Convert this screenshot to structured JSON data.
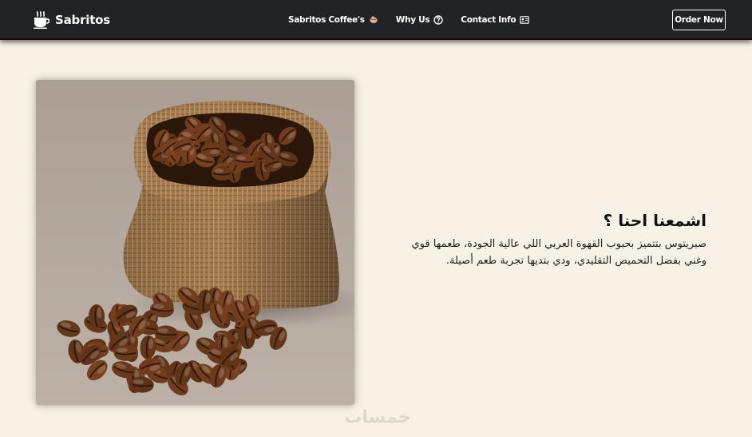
{
  "brand": {
    "name": "Sabritos",
    "icon": "coffee-cup-icon"
  },
  "nav": {
    "items": [
      {
        "label": "Sabritos Coffee's",
        "icon": "coffee-bean-icon"
      },
      {
        "label": "Why Us",
        "icon": "question-circle-icon"
      },
      {
        "label": "Contact Info",
        "icon": "id-card-icon"
      }
    ],
    "order_label": "Order Now"
  },
  "hero": {
    "image": "coffee-beans-sack-photo"
  },
  "about": {
    "title": "اشمعنا احنا ؟",
    "text": "صبريتوس بتتميز بحبوب القهوة العربي اللي عالية الجودة، طعمها قوي وغني بفضل التحميص التقليدي، ودي بتديها تجربة طعم أصيلة."
  },
  "watermark": "خمسات",
  "colors": {
    "navbar": "#202326",
    "page_background": "#f8f2e6",
    "text": "#111111"
  }
}
